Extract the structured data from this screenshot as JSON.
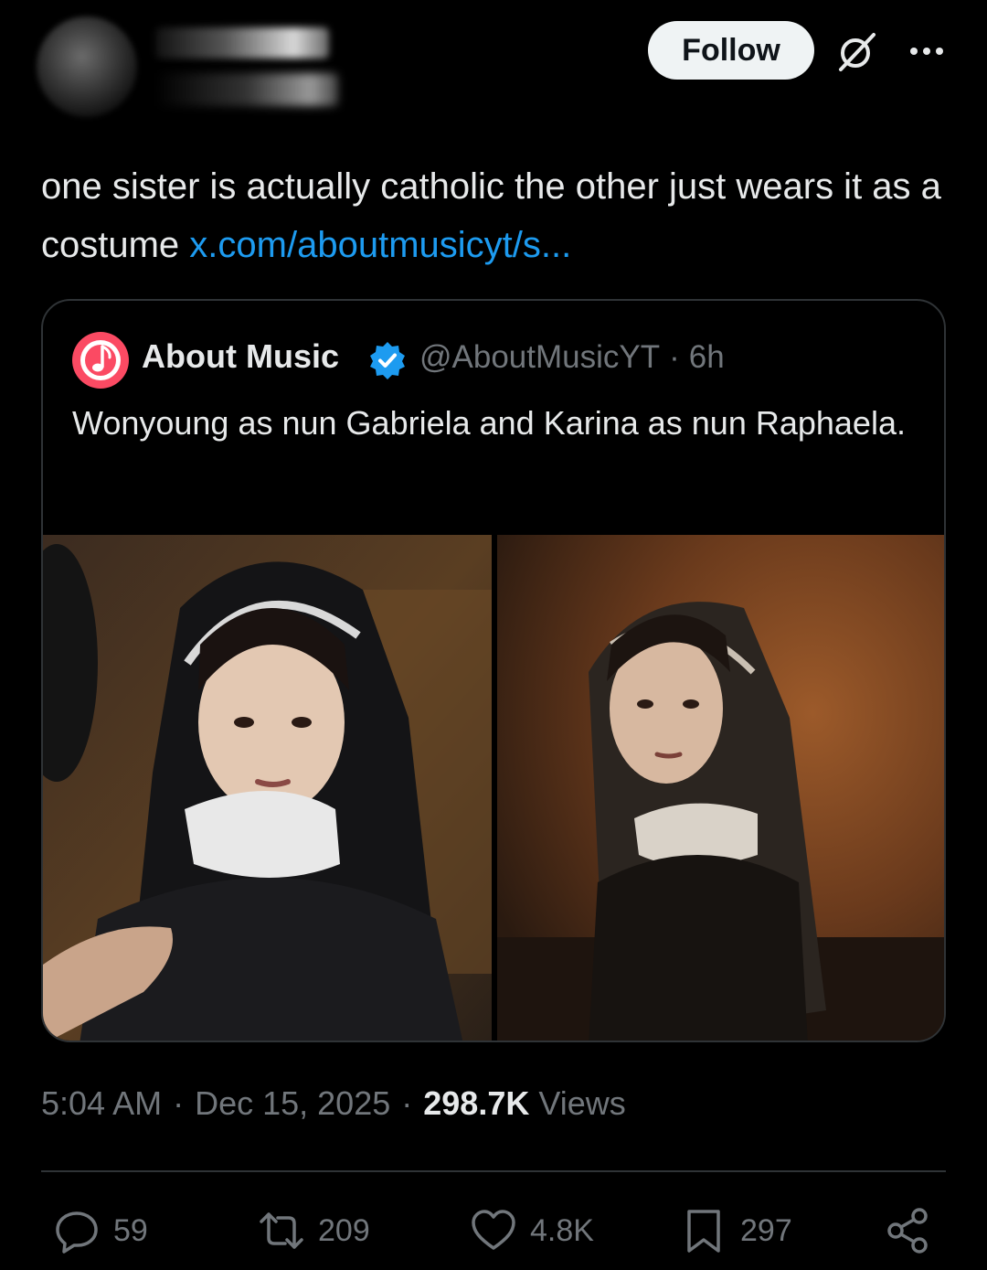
{
  "header": {
    "follow_label": "Follow",
    "grok_icon": "grok-icon",
    "more_icon": "more-dots-icon"
  },
  "tweet": {
    "text": "one sister is actually catholic the other just wears it as a costume",
    "link": "x.com/aboutmusicyt/s..."
  },
  "quote": {
    "name": "About Music",
    "handle": "@AboutMusicYT",
    "separator": "·",
    "time": "6h",
    "text": "Wonyoung as nun Gabriela and Karina as nun Raphaela.",
    "verified_icon": "verified-badge-icon",
    "avatar_icon": "music-note-icon",
    "accent_color": "#1d9bf0",
    "avatar_color": "#fb4a63"
  },
  "meta": {
    "time": "5:04 AM",
    "sep1": "·",
    "date": "Dec 15, 2025",
    "sep2": "·",
    "views_count": "298.7K",
    "views_label": "Views"
  },
  "actions": {
    "replies": "59",
    "reposts": "209",
    "likes": "4.8K",
    "bookmarks": "297"
  },
  "colors": {
    "background": "#000000",
    "text": "#e7e9ea",
    "muted": "#71767b",
    "link": "#1d9bf0",
    "border": "#2f3336"
  }
}
